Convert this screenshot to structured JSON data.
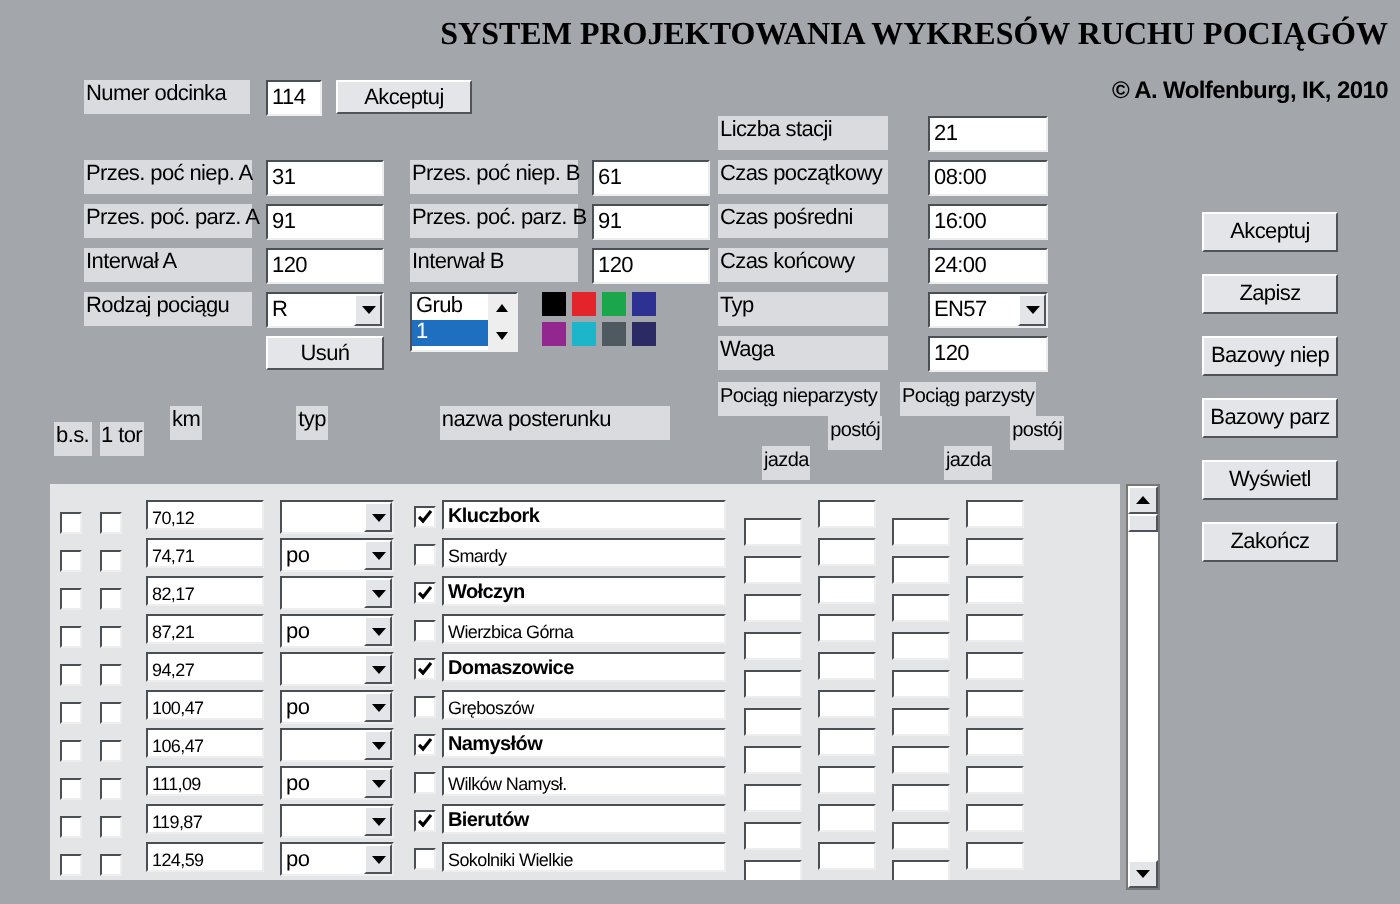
{
  "title": "SYSTEM PROJEKTOWANIA WYKRESÓW RUCHU POCIĄGÓW",
  "copyright": "© A. Wolfenburg, IK, 2010",
  "section": {
    "label": "Numer odcinka",
    "value": "114",
    "button": "Akceptuj"
  },
  "offsets": [
    {
      "label_a": "Przes. poć niep. A",
      "value_a": "31",
      "label_b": "Przes. poć niep. B",
      "value_b": "61"
    },
    {
      "label_a": "Przes. poć. parz. A",
      "value_a": "91",
      "label_b": "Przes. poć. parz. B",
      "value_b": "91"
    },
    {
      "label_a": "Interwał A",
      "value_a": "120",
      "label_b": "Interwał B",
      "value_b": "120"
    }
  ],
  "train_kind": {
    "label": "Rodzaj pociągu",
    "value": "R",
    "button": "Usuń"
  },
  "group_list": [
    {
      "text": "Grub",
      "selected": false
    },
    {
      "text": "1",
      "selected": true
    }
  ],
  "palette": [
    {
      "color": "#000000"
    },
    {
      "color": "#e3242b"
    },
    {
      "color": "#1aa64a"
    },
    {
      "color": "#2e3192"
    },
    {
      "color": "#92278f"
    },
    {
      "color": "#1cb5c9"
    },
    {
      "color": "#4f5a60"
    },
    {
      "color": "#2b2a63"
    }
  ],
  "settings": [
    {
      "label": "Liczba stacji",
      "value": "21",
      "kind": "text"
    },
    {
      "label": "Czas początkowy",
      "value": "08:00",
      "kind": "text"
    },
    {
      "label": "Czas pośredni",
      "value": "16:00",
      "kind": "text"
    },
    {
      "label": "Czas końcowy",
      "value": "24:00",
      "kind": "text"
    },
    {
      "label": "Typ",
      "value": "EN57",
      "kind": "select"
    },
    {
      "label": "Waga",
      "value": "120",
      "kind": "text"
    }
  ],
  "column_headers": {
    "bs": "b.s.",
    "one_track": "1 tor",
    "km": "km",
    "type": "typ",
    "name": "nazwa posterunku"
  },
  "trains": [
    {
      "title": "Pociąg nieparzysty",
      "stop": "postój",
      "run": "jazda"
    },
    {
      "title": "Pociąg parzysty",
      "stop": "postój",
      "run": "jazda"
    }
  ],
  "buttons": [
    "Akceptuj",
    "Zapisz",
    "Bazowy niep",
    "Bazowy parz",
    "Wyświetl",
    "Zakończ"
  ],
  "rows": [
    {
      "bs": false,
      "one_track": false,
      "km": "70,12",
      "main": true,
      "name": "Kluczbork"
    },
    {
      "bs": false,
      "one_track": false,
      "km": "74,71",
      "type": "po",
      "main": false,
      "name": "Smardy"
    },
    {
      "bs": false,
      "one_track": false,
      "km": "82,17",
      "main": true,
      "name": "Wołczyn"
    },
    {
      "bs": false,
      "one_track": false,
      "km": "87,21",
      "type": "po",
      "main": false,
      "name": "Wierzbica Górna"
    },
    {
      "bs": false,
      "one_track": false,
      "km": "94,27",
      "main": true,
      "name": "Domaszowice"
    },
    {
      "bs": false,
      "one_track": false,
      "km": "100,47",
      "type": "po",
      "main": false,
      "name": "Gręboszów"
    },
    {
      "bs": false,
      "one_track": false,
      "km": "106,47",
      "main": true,
      "name": "Namysłów"
    },
    {
      "bs": false,
      "one_track": false,
      "km": "111,09",
      "type": "po",
      "main": false,
      "name": "Wilków Namysł."
    },
    {
      "bs": false,
      "one_track": false,
      "km": "119,87",
      "main": true,
      "name": "Bierutów"
    },
    {
      "bs": false,
      "one_track": false,
      "km": "124,59",
      "type": "po",
      "main": false,
      "name": "Sokolniki Wielkie"
    }
  ]
}
